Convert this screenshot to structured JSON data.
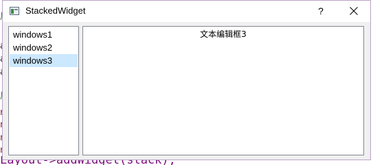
{
  "window": {
    "title": "StackedWidget",
    "help_label": "?"
  },
  "list": {
    "items": [
      {
        "label": "windows1"
      },
      {
        "label": "windows2"
      },
      {
        "label": "windows3"
      }
    ],
    "selected_index": 2
  },
  "editor": {
    "text": "文本编辑框3"
  },
  "background_code": {
    "bottom_line": "Layout->addWidget(stack);",
    "side_chars": [
      "后",
      "a",
      "a",
      "a",
      "后",
      "n",
      "n",
      "n",
      "n"
    ]
  },
  "colors": {
    "selection": "#cce8ff",
    "border": "#828790",
    "window_border": "#b9a2c6"
  }
}
